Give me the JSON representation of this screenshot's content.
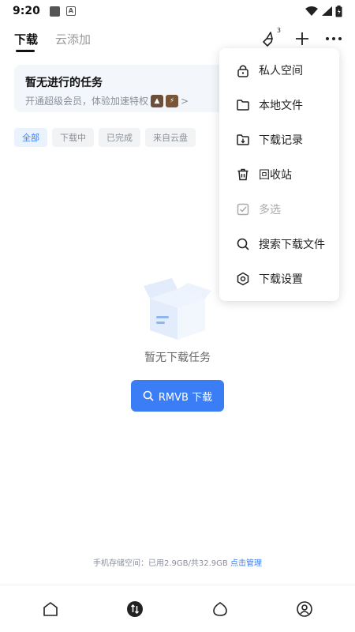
{
  "status_bar": {
    "time": "9:20"
  },
  "header": {
    "tabs": [
      {
        "label": "下载"
      },
      {
        "label": "云添加"
      }
    ],
    "notification_count": "3"
  },
  "promo": {
    "title": "暂无进行的任务",
    "subtitle": "开通超级会员，体验加速特权",
    "arrow": ">"
  },
  "filters": [
    "全部",
    "下载中",
    "已完成",
    "来自云盘"
  ],
  "empty": {
    "message": "暂无下载任务",
    "search_button": "RMVB 下载"
  },
  "storage": {
    "text": "手机存储空间：已用2.9GB/共32.9GB",
    "link": "点击管理"
  },
  "menu": {
    "items": [
      {
        "label": "私人空间",
        "icon": "lock-icon"
      },
      {
        "label": "本地文件",
        "icon": "folder-icon"
      },
      {
        "label": "下载记录",
        "icon": "download-record-icon"
      },
      {
        "label": "回收站",
        "icon": "trash-icon"
      },
      {
        "label": "多选",
        "icon": "checkbox-icon"
      },
      {
        "label": "搜索下载文件",
        "icon": "search-icon"
      },
      {
        "label": "下载设置",
        "icon": "settings-icon"
      }
    ]
  },
  "bottom_nav": [
    "home-icon",
    "transfer-icon",
    "cloud-icon",
    "profile-icon"
  ],
  "colors": {
    "accent": "#3b7df5",
    "promo_bg": "#f3f6fa",
    "chip_bg": "#f2f3f5"
  }
}
